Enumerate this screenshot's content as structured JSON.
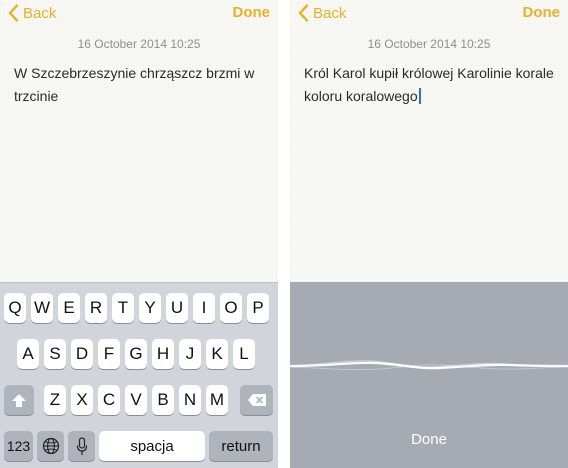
{
  "colors": {
    "accent": "#e6b22c",
    "keyboard_bg": "#d1d4da",
    "dictation_bg": "#a6aab2",
    "caret": "#2f6fdb"
  },
  "left": {
    "back_label": "Back",
    "done_label": "Done",
    "date": "16 October 2014 10:25",
    "note_text": "W Szczebrzeszynie chrząszcz brzmi w trzcinie",
    "keyboard": {
      "row1": [
        "Q",
        "W",
        "E",
        "R",
        "T",
        "Y",
        "U",
        "I",
        "O",
        "P"
      ],
      "row2": [
        "A",
        "S",
        "D",
        "F",
        "G",
        "H",
        "J",
        "K",
        "L"
      ],
      "row3": [
        "Z",
        "X",
        "C",
        "V",
        "B",
        "N",
        "M"
      ],
      "numbers_label": "123",
      "space_label": "spacja",
      "return_label": "return",
      "icons": [
        "shift-icon",
        "delete-icon",
        "globe-icon",
        "microphone-icon"
      ]
    }
  },
  "right": {
    "back_label": "Back",
    "done_label": "Done",
    "date": "16 October 2014 10:25",
    "note_text": "Król Karol kupił królowej Karolinie korale koloru koralowego",
    "dictation_done_label": "Done"
  }
}
